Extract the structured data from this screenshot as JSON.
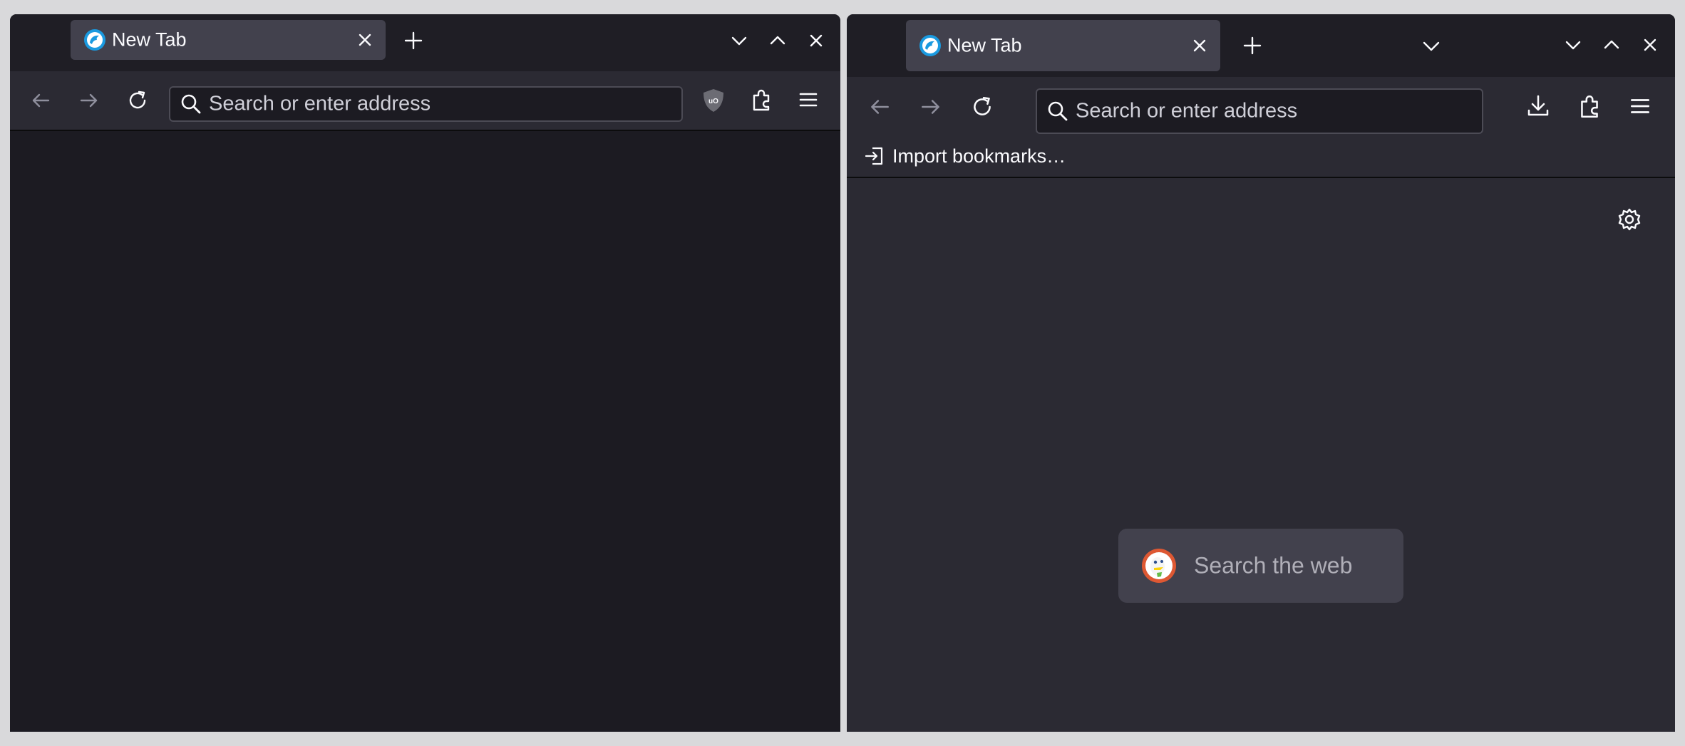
{
  "windows": {
    "left": {
      "tab": {
        "title": "New Tab",
        "favicon": "browser-logo-icon"
      },
      "urlbar": {
        "placeholder": "Search or enter address"
      },
      "toolbar_icons": [
        "back-arrow-icon",
        "forward-arrow-icon",
        "reload-icon",
        "ublock-origin-icon",
        "extensions-icon",
        "menu-icon"
      ],
      "window_controls": [
        "list-all-tabs-icon",
        "maximize-icon",
        "close-icon"
      ]
    },
    "right": {
      "tab": {
        "title": "New Tab",
        "favicon": "browser-logo-icon"
      },
      "urlbar": {
        "placeholder": "Search or enter address"
      },
      "toolbar_icons": [
        "back-arrow-icon",
        "forward-arrow-icon",
        "reload-icon",
        "downloads-icon",
        "extensions-icon",
        "menu-icon"
      ],
      "window_controls": [
        "list-all-tabs-icon",
        "minimize-icon",
        "maximize-icon",
        "close-icon"
      ],
      "bookmarks_toolbar": {
        "import_label": "Import bookmarks…"
      },
      "newtab": {
        "search_placeholder": "Search the web",
        "search_engine_icon": "duckduckgo-icon",
        "settings_icon": "gear-icon"
      }
    }
  },
  "colors": {
    "tabstrip_bg": "#1f1e25",
    "toolbar_bg": "#2b2a33",
    "selected_tab_bg": "#42414d",
    "content_bg_left": "#1c1b22",
    "content_bg_right": "#2b2a33",
    "text": "#fbfbfe"
  }
}
